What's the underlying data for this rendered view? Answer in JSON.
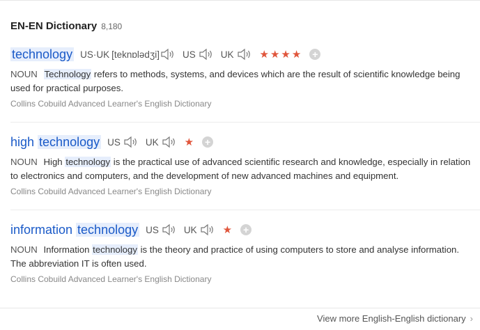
{
  "header": {
    "title": "EN-EN Dictionary",
    "count": "8,180"
  },
  "entries": [
    {
      "word_prefix": "",
      "word_highlight": "technology",
      "pron": {
        "us_uk_label": "US·UK",
        "ipa": "[teknɒlədʒi]",
        "us_label": "US",
        "uk_label": "UK"
      },
      "stars": "★★★★",
      "pos": "NOUN",
      "def_highlight": "Technology",
      "def_rest": " refers to methods, systems, and devices which are the result of scientific knowledge being used for practical purposes.",
      "source": "Collins Cobuild Advanced Learner's English Dictionary"
    },
    {
      "word_prefix": "high ",
      "word_highlight": "technology",
      "pron": {
        "us_label": "US",
        "uk_label": "UK"
      },
      "stars": "★",
      "pos": "NOUN",
      "def_before": "High ",
      "def_highlight": "technology",
      "def_rest": " is the practical use of advanced scientific research and knowledge, especially in relation to electronics and computers, and the development of new advanced machines and equipment.",
      "source": "Collins Cobuild Advanced Learner's English Dictionary"
    },
    {
      "word_prefix": "information ",
      "word_highlight": "technology",
      "pron": {
        "us_label": "US",
        "uk_label": "UK"
      },
      "stars": "★",
      "pos": "NOUN",
      "def_before": "Information ",
      "def_highlight": "technology",
      "def_rest": " is the theory and practice of using computers to store and analyse information. The abbreviation IT is often used.",
      "source": "Collins Cobuild Advanced Learner's English Dictionary"
    }
  ],
  "footer": {
    "more_label": "View more English-English dictionary",
    "chevron": "›"
  },
  "colors": {
    "link": "#1a5ac8",
    "star": "#e0553b",
    "highlight": "#e6eefc"
  },
  "icons": {
    "speaker": "speaker-icon",
    "add": "add-icon",
    "chevron": "chevron-right-icon"
  }
}
